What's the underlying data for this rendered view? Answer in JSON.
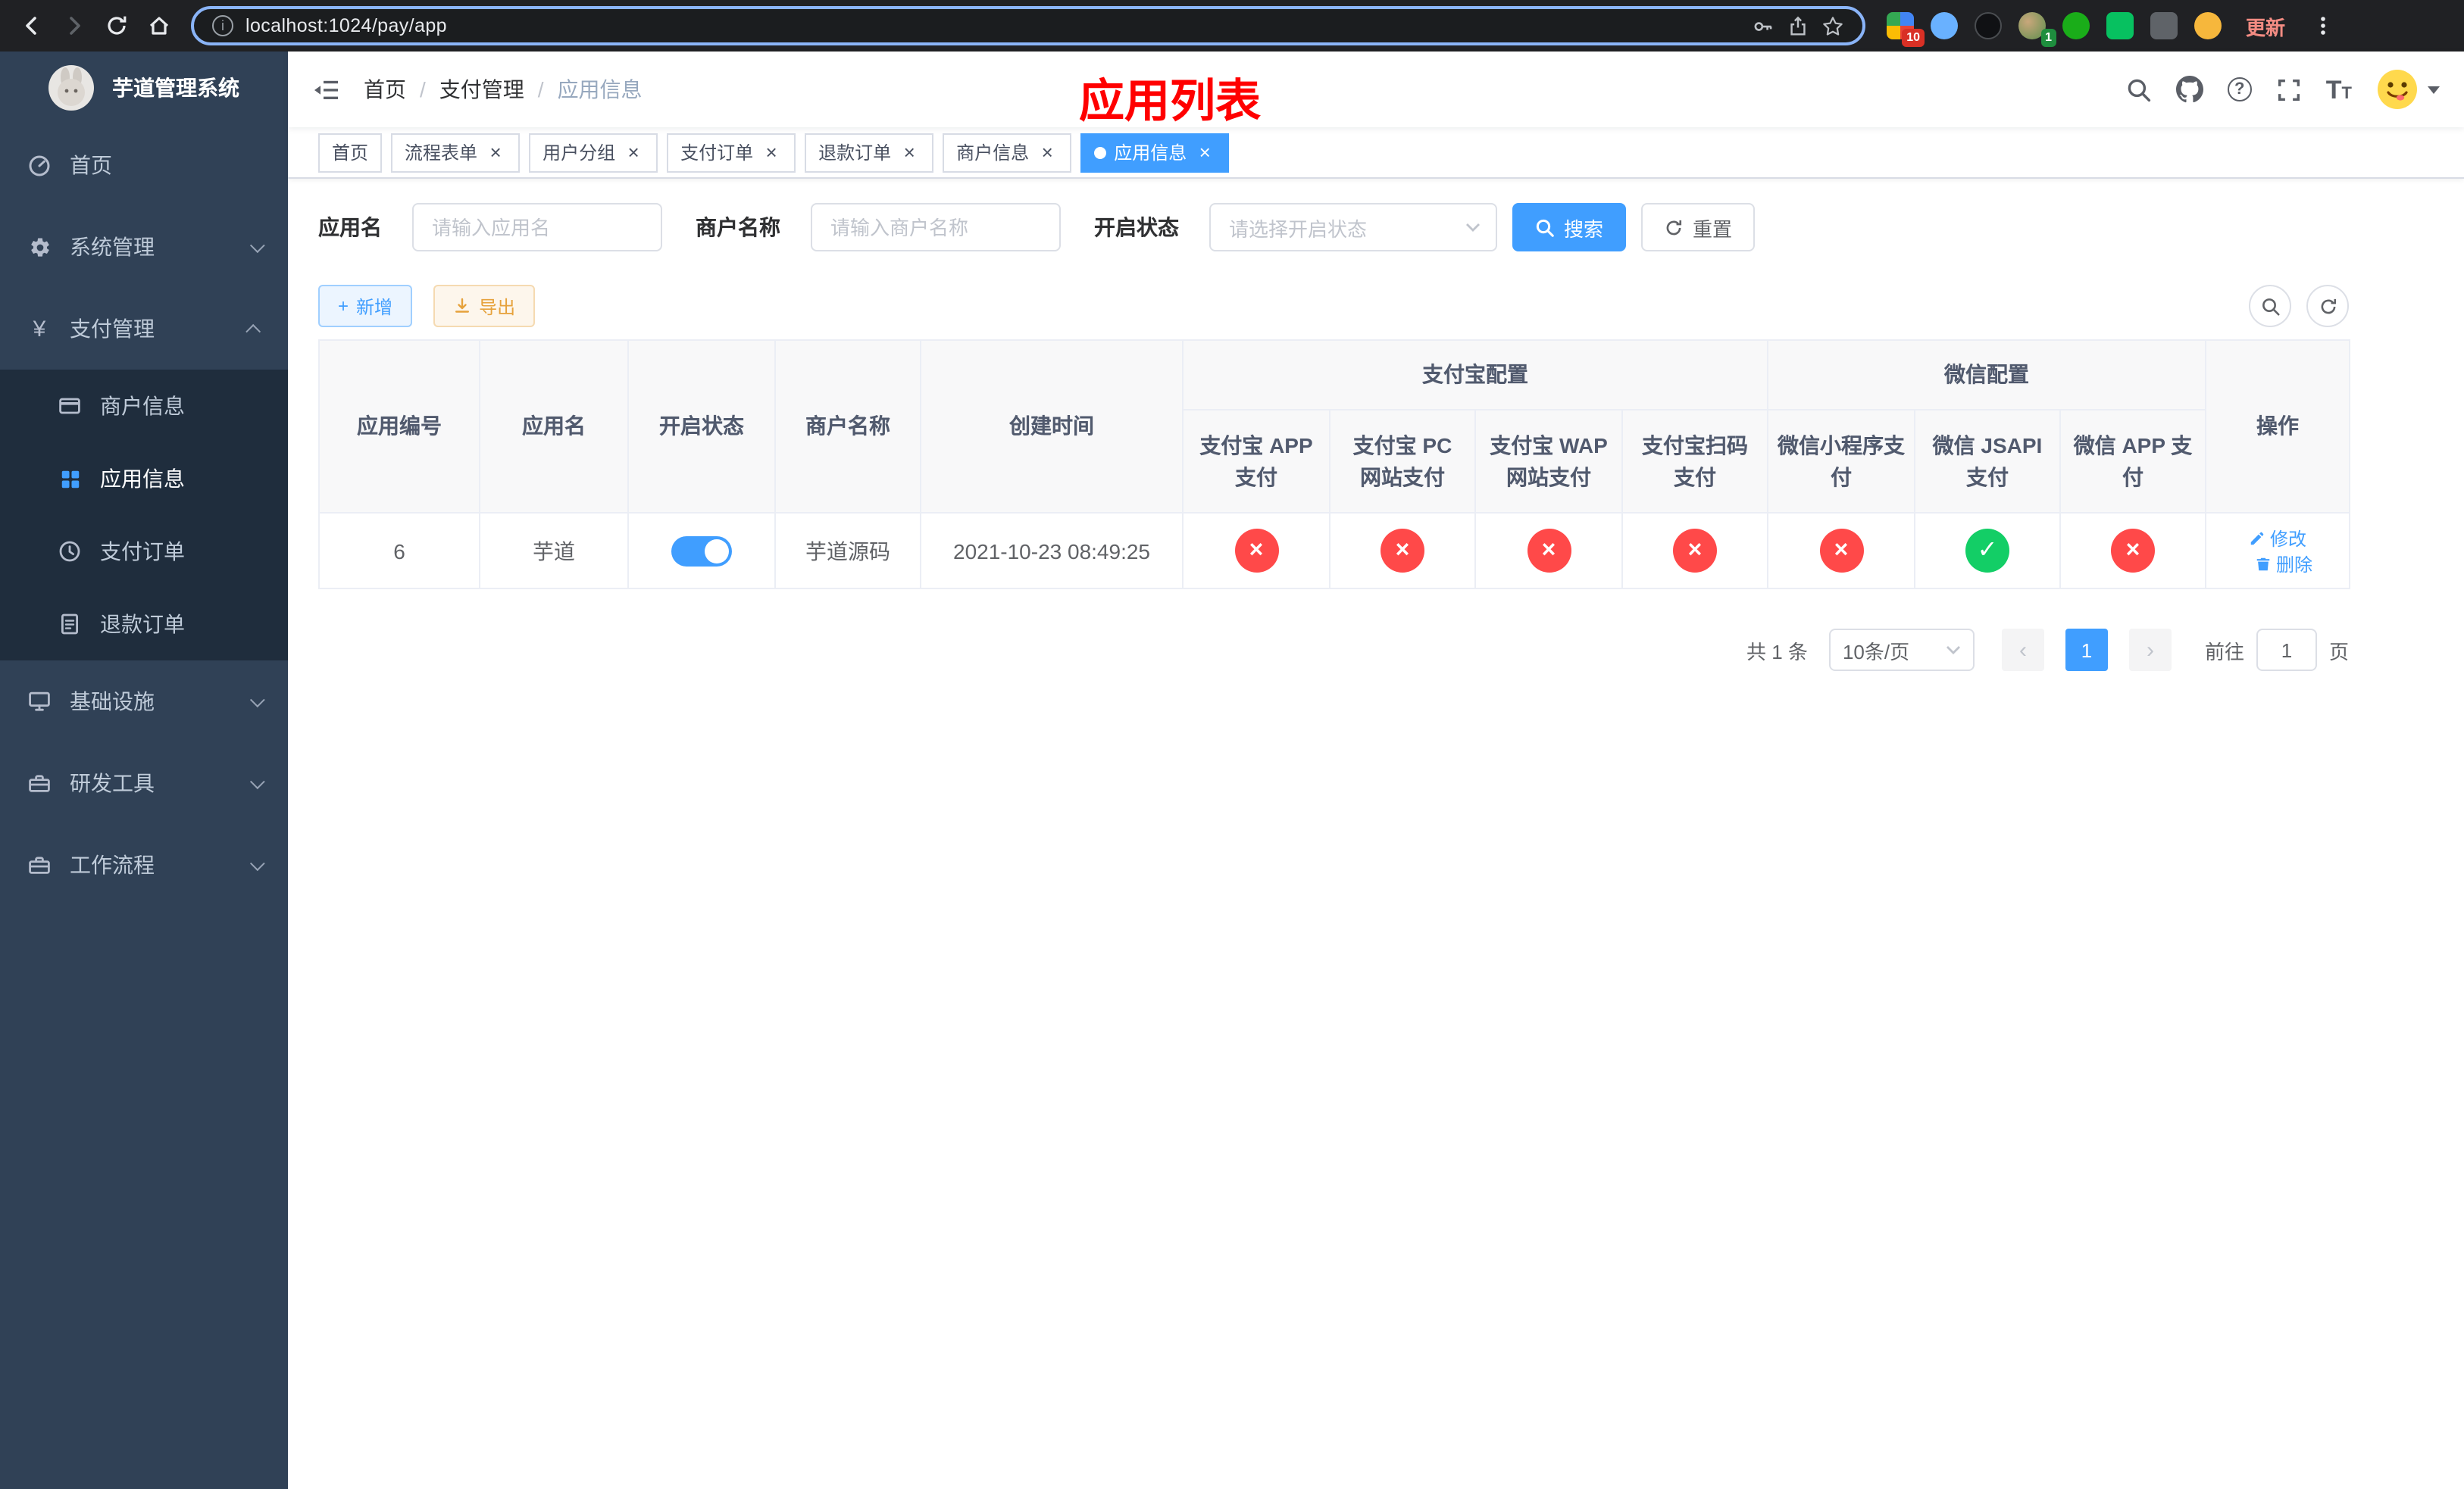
{
  "colors": {
    "accent": "#409eff",
    "danger": "#ff4949",
    "success": "#13ce66",
    "title_red": "#ff0000",
    "sidebar_bg": "#304156",
    "submenu_bg": "#1f2d3d",
    "chrome_bg": "#202124"
  },
  "icons": {
    "info": "i",
    "question": "?",
    "cross": "×",
    "check": "✓",
    "close": "×",
    "plus": "+",
    "prev": "‹",
    "next": "›",
    "yen": "¥",
    "font_big": "T",
    "font_small": "T"
  },
  "browser": {
    "url": "localhost:1024/pay/app",
    "update_label": "更新",
    "extension_badge_1": "10",
    "extension_badge_2": "1"
  },
  "sidebar": {
    "title": "芋道管理系统",
    "items": [
      {
        "label": "首页"
      },
      {
        "label": "系统管理"
      },
      {
        "label": "支付管理"
      },
      {
        "label": "基础设施"
      },
      {
        "label": "研发工具"
      },
      {
        "label": "工作流程"
      }
    ],
    "submenu": [
      {
        "label": "商户信息"
      },
      {
        "label": "应用信息"
      },
      {
        "label": "支付订单"
      },
      {
        "label": "退款订单"
      }
    ]
  },
  "breadcrumb": {
    "separator": "/",
    "items": [
      {
        "label": "首页"
      },
      {
        "label": "支付管理"
      },
      {
        "label": "应用信息"
      }
    ]
  },
  "page_title": "应用列表",
  "tabs": [
    {
      "label": "首页"
    },
    {
      "label": "流程表单"
    },
    {
      "label": "用户分组"
    },
    {
      "label": "支付订单"
    },
    {
      "label": "退款订单"
    },
    {
      "label": "商户信息"
    },
    {
      "label": "应用信息"
    }
  ],
  "filters": {
    "app_name_label": "应用名",
    "app_name_placeholder": "请输入应用名",
    "merchant_label": "商户名称",
    "merchant_placeholder": "请输入商户名称",
    "status_label": "开启状态",
    "status_placeholder": "请选择开启状态",
    "search_label": "搜索",
    "reset_label": "重置"
  },
  "toolbar": {
    "add_label": "新增",
    "export_label": "导出"
  },
  "table": {
    "headers": {
      "app_id": "应用编号",
      "app_name": "应用名",
      "status": "开启状态",
      "merchant_name": "商户名称",
      "create_time": "创建时间",
      "alipay_group": "支付宝配置",
      "wechat_group": "微信配置",
      "alipay_app": "支付宝 APP 支付",
      "alipay_pc": "支付宝 PC 网站支付",
      "alipay_wap": "支付宝 WAP 网站支付",
      "alipay_qr": "支付宝扫码支付",
      "wechat_lite": "微信小程序支付",
      "wechat_jsapi": "微信 JSAPI 支付",
      "wechat_app": "微信 APP 支付",
      "actions": "操作"
    },
    "rows": [
      {
        "app_id": "6",
        "app_name": "芋道",
        "status": "on",
        "merchant_name": "芋道源码",
        "create_time": "2021-10-23 08:49:25",
        "alipay_app": "disabled",
        "alipay_pc": "disabled",
        "alipay_wap": "disabled",
        "alipay_qr": "disabled",
        "wechat_lite": "disabled",
        "wechat_jsapi": "enabled",
        "wechat_app": "disabled",
        "edit_label": "修改",
        "delete_label": "删除"
      }
    ]
  },
  "pagination": {
    "total_label": "共 1 条",
    "page_size": "10条/页",
    "page": "1",
    "goto_label": "前往",
    "goto_value": "1",
    "page_unit": "页"
  }
}
